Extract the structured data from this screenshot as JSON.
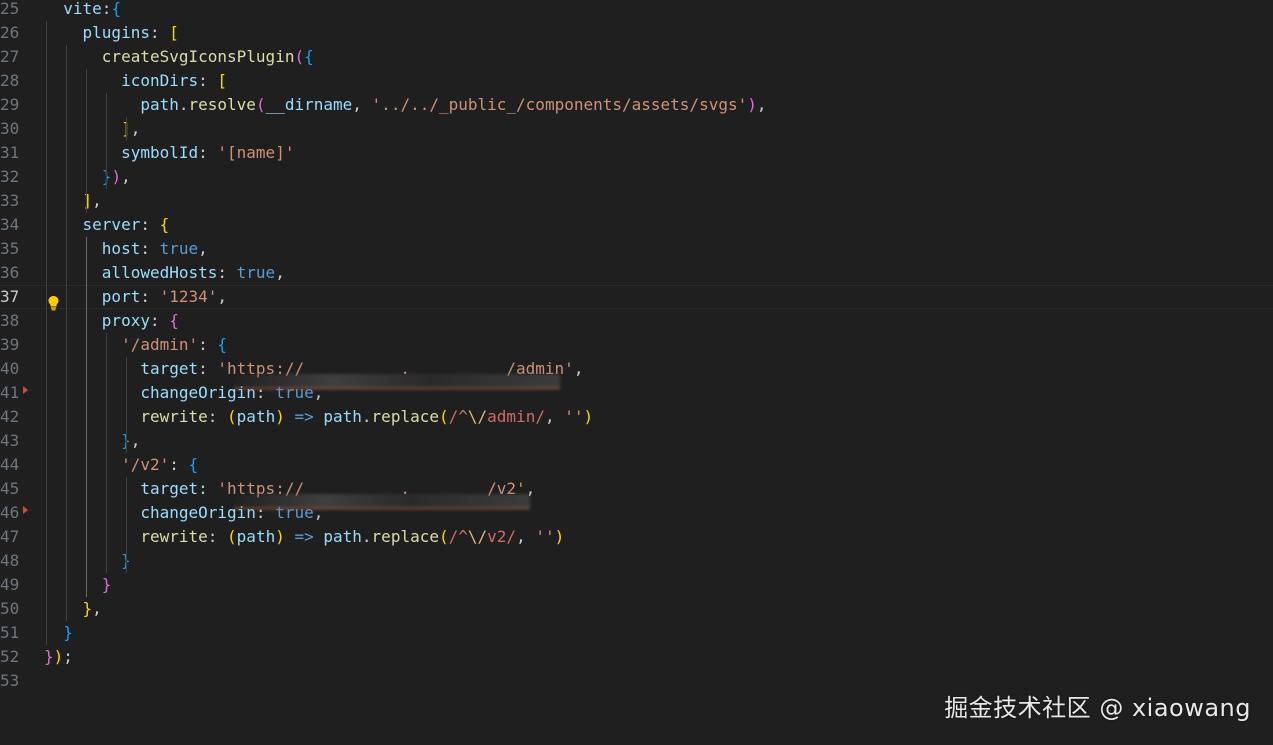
{
  "editor": {
    "current_line": 37,
    "lines": [
      {
        "n": "25",
        "tokens": [
          {
            "t": "  ",
            "c": ""
          },
          {
            "t": "vite",
            "c": "t-prop"
          },
          {
            "t": ":",
            "c": "t-p"
          },
          {
            "t": "{",
            "c": "b3"
          }
        ]
      },
      {
        "n": "26",
        "tokens": [
          {
            "t": "    ",
            "c": ""
          },
          {
            "t": "plugins",
            "c": "t-prop"
          },
          {
            "t": ": ",
            "c": "t-p"
          },
          {
            "t": "[",
            "c": "b1"
          }
        ]
      },
      {
        "n": "27",
        "tokens": [
          {
            "t": "      ",
            "c": ""
          },
          {
            "t": "createSvgIconsPlugin",
            "c": "t-fn"
          },
          {
            "t": "(",
            "c": "b2"
          },
          {
            "t": "{",
            "c": "b3"
          }
        ]
      },
      {
        "n": "28",
        "tokens": [
          {
            "t": "        ",
            "c": ""
          },
          {
            "t": "iconDirs",
            "c": "t-prop"
          },
          {
            "t": ": ",
            "c": "t-p"
          },
          {
            "t": "[",
            "c": "b1"
          }
        ]
      },
      {
        "n": "29",
        "tokens": [
          {
            "t": "          ",
            "c": ""
          },
          {
            "t": "path",
            "c": "t-prop"
          },
          {
            "t": ".",
            "c": "t-p"
          },
          {
            "t": "resolve",
            "c": "t-fn"
          },
          {
            "t": "(",
            "c": "b2"
          },
          {
            "t": "__dirname",
            "c": "t-prop"
          },
          {
            "t": ", ",
            "c": "t-p"
          },
          {
            "t": "'../../_public_/components/assets/svgs'",
            "c": "t-str"
          },
          {
            "t": ")",
            "c": "b2"
          },
          {
            "t": ",",
            "c": "t-p"
          }
        ]
      },
      {
        "n": "30",
        "tokens": [
          {
            "t": "        ",
            "c": ""
          },
          {
            "t": "]",
            "c": "b1"
          },
          {
            "t": ",",
            "c": "t-p"
          }
        ]
      },
      {
        "n": "31",
        "tokens": [
          {
            "t": "        ",
            "c": ""
          },
          {
            "t": "symbolId",
            "c": "t-prop"
          },
          {
            "t": ": ",
            "c": "t-p"
          },
          {
            "t": "'[name]'",
            "c": "t-str"
          }
        ]
      },
      {
        "n": "32",
        "tokens": [
          {
            "t": "      ",
            "c": ""
          },
          {
            "t": "}",
            "c": "b3"
          },
          {
            "t": ")",
            "c": "b2"
          },
          {
            "t": ",",
            "c": "t-p"
          }
        ]
      },
      {
        "n": "33",
        "tokens": [
          {
            "t": "    ",
            "c": ""
          },
          {
            "t": "]",
            "c": "b1"
          },
          {
            "t": ",",
            "c": "t-p"
          }
        ]
      },
      {
        "n": "34",
        "tokens": [
          {
            "t": "    ",
            "c": ""
          },
          {
            "t": "server",
            "c": "t-prop"
          },
          {
            "t": ": ",
            "c": "t-p"
          },
          {
            "t": "{",
            "c": "b1"
          }
        ]
      },
      {
        "n": "35",
        "tokens": [
          {
            "t": "      ",
            "c": ""
          },
          {
            "t": "host",
            "c": "t-prop"
          },
          {
            "t": ": ",
            "c": "t-p"
          },
          {
            "t": "true",
            "c": "t-kw"
          },
          {
            "t": ",",
            "c": "t-p"
          }
        ]
      },
      {
        "n": "36",
        "tokens": [
          {
            "t": "      ",
            "c": ""
          },
          {
            "t": "allowedHosts",
            "c": "t-prop"
          },
          {
            "t": ": ",
            "c": "t-p"
          },
          {
            "t": "true",
            "c": "t-kw"
          },
          {
            "t": ",",
            "c": "t-p"
          }
        ]
      },
      {
        "n": "37",
        "tokens": [
          {
            "t": "      ",
            "c": ""
          },
          {
            "t": "port",
            "c": "t-prop"
          },
          {
            "t": ": ",
            "c": "t-p"
          },
          {
            "t": "'1234'",
            "c": "t-str"
          },
          {
            "t": ",",
            "c": "t-p"
          }
        ]
      },
      {
        "n": "38",
        "tokens": [
          {
            "t": "      ",
            "c": ""
          },
          {
            "t": "proxy",
            "c": "t-prop"
          },
          {
            "t": ": ",
            "c": "t-p"
          },
          {
            "t": "{",
            "c": "b2"
          }
        ]
      },
      {
        "n": "39",
        "tokens": [
          {
            "t": "        ",
            "c": ""
          },
          {
            "t": "'/admin'",
            "c": "t-str"
          },
          {
            "t": ": ",
            "c": "t-p"
          },
          {
            "t": "{",
            "c": "b3"
          }
        ]
      },
      {
        "n": "40",
        "tokens": [
          {
            "t": "          ",
            "c": ""
          },
          {
            "t": "target",
            "c": "t-prop"
          },
          {
            "t": ": ",
            "c": "t-p"
          },
          {
            "t": "'https://          .          /admin'",
            "c": "t-str"
          },
          {
            "t": ",",
            "c": "t-p"
          }
        ]
      },
      {
        "n": "41",
        "tokens": [
          {
            "t": "          ",
            "c": ""
          },
          {
            "t": "changeOrigin",
            "c": "t-prop"
          },
          {
            "t": ": ",
            "c": "t-p"
          },
          {
            "t": "true",
            "c": "t-kw"
          },
          {
            "t": ",",
            "c": "t-p"
          }
        ]
      },
      {
        "n": "42",
        "tokens": [
          {
            "t": "          ",
            "c": ""
          },
          {
            "t": "rewrite",
            "c": "t-fn"
          },
          {
            "t": ": ",
            "c": "t-p"
          },
          {
            "t": "(",
            "c": "b1"
          },
          {
            "t": "path",
            "c": "t-prop"
          },
          {
            "t": ")",
            "c": "b1"
          },
          {
            "t": " => ",
            "c": "t-kw"
          },
          {
            "t": "path",
            "c": "t-prop"
          },
          {
            "t": ".",
            "c": "t-p"
          },
          {
            "t": "replace",
            "c": "t-fn"
          },
          {
            "t": "(",
            "c": "b1"
          },
          {
            "t": "/^",
            "c": "t-re"
          },
          {
            "t": "\\/",
            "c": "t-esc"
          },
          {
            "t": "admin/",
            "c": "t-re"
          },
          {
            "t": ", ",
            "c": "t-p"
          },
          {
            "t": "''",
            "c": "t-str"
          },
          {
            "t": ")",
            "c": "b1"
          }
        ]
      },
      {
        "n": "43",
        "tokens": [
          {
            "t": "        ",
            "c": ""
          },
          {
            "t": "}",
            "c": "b3"
          },
          {
            "t": ",",
            "c": "t-p"
          }
        ]
      },
      {
        "n": "44",
        "tokens": [
          {
            "t": "        ",
            "c": ""
          },
          {
            "t": "'/v2'",
            "c": "t-str"
          },
          {
            "t": ": ",
            "c": "t-p"
          },
          {
            "t": "{",
            "c": "b3"
          }
        ]
      },
      {
        "n": "45",
        "tokens": [
          {
            "t": "          ",
            "c": ""
          },
          {
            "t": "target",
            "c": "t-prop"
          },
          {
            "t": ": ",
            "c": "t-p"
          },
          {
            "t": "'https://          .        /v2'",
            "c": "t-str"
          },
          {
            "t": ",",
            "c": "t-p"
          }
        ]
      },
      {
        "n": "46",
        "tokens": [
          {
            "t": "          ",
            "c": ""
          },
          {
            "t": "changeOrigin",
            "c": "t-prop"
          },
          {
            "t": ": ",
            "c": "t-p"
          },
          {
            "t": "true",
            "c": "t-kw"
          },
          {
            "t": ",",
            "c": "t-p"
          }
        ]
      },
      {
        "n": "47",
        "tokens": [
          {
            "t": "          ",
            "c": ""
          },
          {
            "t": "rewrite",
            "c": "t-fn"
          },
          {
            "t": ": ",
            "c": "t-p"
          },
          {
            "t": "(",
            "c": "b1"
          },
          {
            "t": "path",
            "c": "t-prop"
          },
          {
            "t": ")",
            "c": "b1"
          },
          {
            "t": " => ",
            "c": "t-kw"
          },
          {
            "t": "path",
            "c": "t-prop"
          },
          {
            "t": ".",
            "c": "t-p"
          },
          {
            "t": "replace",
            "c": "t-fn"
          },
          {
            "t": "(",
            "c": "b1"
          },
          {
            "t": "/^",
            "c": "t-re"
          },
          {
            "t": "\\/",
            "c": "t-esc"
          },
          {
            "t": "v2/",
            "c": "t-re"
          },
          {
            "t": ", ",
            "c": "t-p"
          },
          {
            "t": "''",
            "c": "t-str"
          },
          {
            "t": ")",
            "c": "b1"
          }
        ]
      },
      {
        "n": "48",
        "tokens": [
          {
            "t": "        ",
            "c": ""
          },
          {
            "t": "}",
            "c": "b3"
          }
        ]
      },
      {
        "n": "49",
        "tokens": [
          {
            "t": "      ",
            "c": ""
          },
          {
            "t": "}",
            "c": "b2"
          }
        ]
      },
      {
        "n": "50",
        "tokens": [
          {
            "t": "    ",
            "c": ""
          },
          {
            "t": "}",
            "c": "b1"
          },
          {
            "t": ",",
            "c": "t-p"
          }
        ]
      },
      {
        "n": "51",
        "tokens": [
          {
            "t": "  ",
            "c": ""
          },
          {
            "t": "}",
            "c": "b3"
          }
        ]
      },
      {
        "n": "52",
        "tokens": [
          {
            "t": "}",
            "c": "b2"
          },
          {
            "t": ")",
            "c": "b1"
          },
          {
            "t": ";",
            "c": "t-p"
          }
        ]
      },
      {
        "n": "53",
        "tokens": []
      }
    ]
  },
  "watermark": "掘金技术社区 @ xiaowang",
  "icons": {
    "lightbulb": "lightbulb-icon",
    "change_marker": "git-change-marker-icon"
  },
  "colors": {
    "background": "#1f1f1f",
    "property": "#9cdcfe",
    "function": "#dcdcaa",
    "string": "#ce9178",
    "keyword": "#569cd6"
  }
}
